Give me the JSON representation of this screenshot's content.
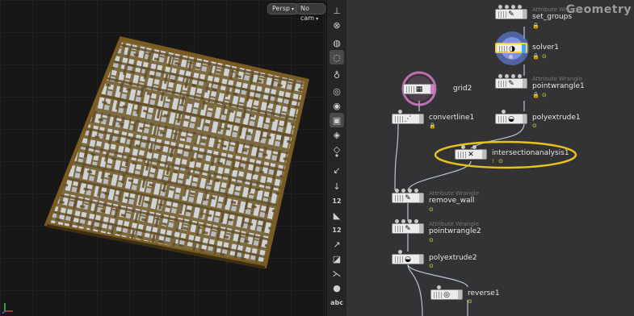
{
  "viewport": {
    "persp_label": "Persp",
    "cam_label": "No cam",
    "dropdown_glyph": "▾"
  },
  "toolbar": {
    "items": [
      {
        "icon": "pin-icon",
        "glyph": "⊥"
      },
      {
        "icon": "close-icon",
        "glyph": "⊗"
      },
      {
        "icon": "globe-icon",
        "glyph": "◍"
      },
      {
        "icon": "light-icon",
        "glyph": "◌"
      },
      {
        "icon": "bulb-icon",
        "glyph": "♁"
      },
      {
        "icon": "display-icon",
        "glyph": "◎"
      },
      {
        "icon": "camera-icon",
        "glyph": "◉"
      },
      {
        "icon": "snapshot-icon",
        "glyph": "▣"
      },
      {
        "icon": "eye-icon",
        "glyph": "◈"
      },
      {
        "icon": "eye-slash-icon",
        "glyph": "◇"
      },
      {
        "icon": "point-icon",
        "glyph": "•"
      },
      {
        "icon": "normal-icon",
        "glyph": "↙"
      },
      {
        "icon": "vertex-icon",
        "glyph": "↓"
      },
      {
        "icon": "number-icon",
        "glyph": "12",
        "text": true
      },
      {
        "icon": "paint-icon",
        "glyph": "◣"
      },
      {
        "icon": "number-icon-2",
        "glyph": "12",
        "text": true
      },
      {
        "icon": "edge-icon",
        "glyph": "↗"
      },
      {
        "icon": "primitive-icon",
        "glyph": "◪"
      },
      {
        "icon": "wire-icon",
        "glyph": "⋋"
      },
      {
        "icon": "sphere-icon",
        "glyph": "●"
      },
      {
        "icon": "text-icon",
        "glyph": "abc",
        "text": true
      }
    ]
  },
  "network": {
    "title": "Geometry",
    "badge_glyphs": {
      "lock": "🔒",
      "flag": "⊙",
      "warning": "!"
    },
    "nodes": {
      "set_groups": {
        "name": "set_groups",
        "type": "Attribute Wrangle"
      },
      "solver1": {
        "name": "solver1"
      },
      "pointwrangle1": {
        "name": "pointwrangle1",
        "type": "Attribute Wrangle"
      },
      "grid2": {
        "name": "grid2"
      },
      "convertline1": {
        "name": "convertline1"
      },
      "polyextrude1": {
        "name": "polyextrude1"
      },
      "intersectionanalysis1": {
        "name": "intersectionanalysis1"
      },
      "remove_wall": {
        "name": "remove_wall",
        "type": "Attribute Wrangle"
      },
      "pointwrangle2": {
        "name": "pointwrangle2",
        "type": "Attribute Wrangle"
      },
      "polyextrude2": {
        "name": "polyextrude2"
      },
      "reverse1": {
        "name": "reverse1"
      }
    }
  },
  "colors": {
    "highlight_ellipse": "#e6c21c",
    "grid_selected": "#d77ac6",
    "solver_glow": "#6b8bff",
    "maze_wall": "#8b6a2c",
    "maze_floor": "#c9c9c9"
  }
}
